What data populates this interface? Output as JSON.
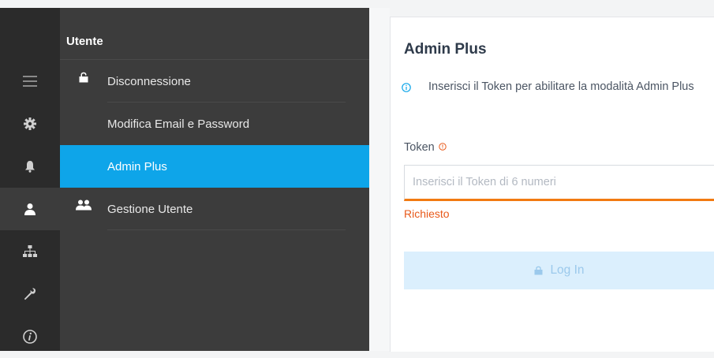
{
  "rail": {
    "items": [
      {
        "icon": "hamburger-menu-icon"
      },
      {
        "icon": "gear-icon"
      },
      {
        "icon": "bell-icon"
      },
      {
        "icon": "user-icon",
        "active": true
      },
      {
        "icon": "network-icon"
      },
      {
        "icon": "wrench-icon"
      },
      {
        "icon": "info-icon"
      }
    ]
  },
  "menu": {
    "header": "Utente",
    "items": [
      {
        "label": "Disconnessione",
        "icon": "lock-icon"
      },
      {
        "label": "Modifica Email e Password"
      },
      {
        "label": "Admin Plus",
        "active": true
      },
      {
        "label": "Gestione Utente",
        "icon": "users-icon"
      }
    ]
  },
  "panel": {
    "title": "Admin Plus",
    "info_text": "Inserisci il Token per abilitare la modalità Admin Plus",
    "token_label": "Token",
    "token_placeholder": "Inserisci il Token di 6 numeri",
    "token_value": "",
    "error_text": "Richiesto",
    "login_label": "Log In"
  },
  "colors": {
    "accent": "#0ea5e9",
    "error": "#e8591a",
    "input_underline": "#f27a11",
    "button_disabled_bg": "#dbeffd"
  }
}
